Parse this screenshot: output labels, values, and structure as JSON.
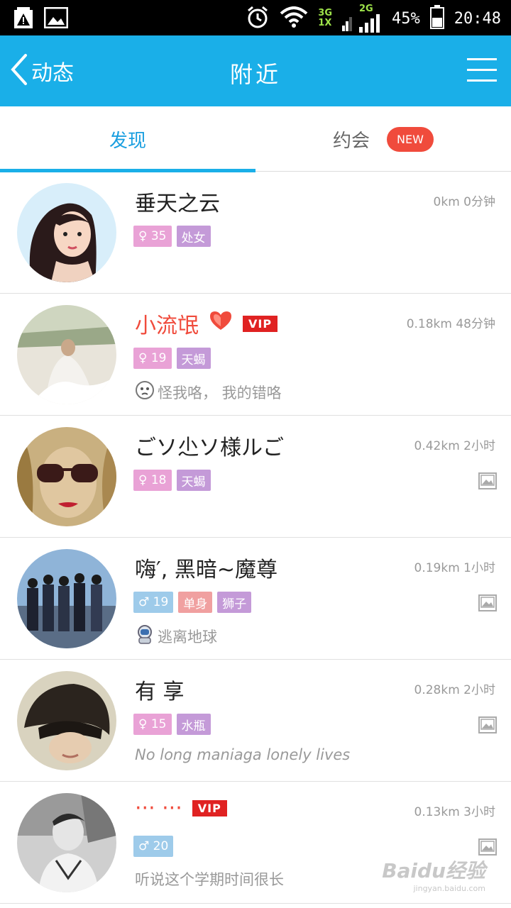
{
  "status_bar": {
    "network_top": "3G",
    "network_bottom": "1X",
    "network_2g": "2G",
    "battery": "45%",
    "time": "20:48",
    "icons": [
      "warning-battery-icon",
      "image-icon",
      "alarm-icon",
      "wifi-icon",
      "signal-icon",
      "battery-icon"
    ]
  },
  "header": {
    "back_label": "动态",
    "title": "附近",
    "background": "#1aafe8"
  },
  "tabs": {
    "discover": "发现",
    "date": "约会",
    "new_badge": "NEW"
  },
  "users": [
    {
      "name": "垂天之云",
      "meta": "0km 0分钟",
      "gender": "female",
      "age": "35",
      "tags": [
        "处女"
      ],
      "signature": "",
      "vip": false,
      "heart": false,
      "photos": false
    },
    {
      "name": "小流氓",
      "meta": "0.18km 48分钟",
      "gender": "female",
      "age": "19",
      "tags": [
        "天蝎"
      ],
      "signature": "怪我咯， 我的错咯",
      "vip": true,
      "vip_label": "VIP",
      "heart": true,
      "photos": false
    },
    {
      "name": "ごソ尐ソ様ルご",
      "meta": "0.42km 2小时",
      "gender": "female",
      "age": "18",
      "tags": [
        "天蝎"
      ],
      "signature": "",
      "vip": false,
      "heart": false,
      "photos": true
    },
    {
      "name": "嗨′, 黑暗~魔尊",
      "meta": "0.19km 1小时",
      "gender": "male",
      "age": "19",
      "tags": [
        "单身",
        "狮子"
      ],
      "signature": "逃离地球",
      "vip": false,
      "heart": false,
      "photos": true
    },
    {
      "name": "有 享",
      "meta": "0.28km 2小时",
      "gender": "female",
      "age": "15",
      "tags": [
        "水瓶"
      ],
      "signature": "No long maniaga lonely lives",
      "vip": false,
      "heart": false,
      "photos": true
    },
    {
      "name": "··· ···",
      "meta": "0.13km 3小时",
      "gender": "male",
      "age": "20",
      "tags": [],
      "signature": "听说这个学期时间很长",
      "vip": true,
      "vip_label": "VIP",
      "heart": false,
      "photos": true
    }
  ],
  "watermark": {
    "main": "Baidu经验",
    "sub": "jingyan.baidu.com"
  },
  "colors": {
    "accent": "#1aafe8",
    "tag_female": "#e9a2d6",
    "tag_male": "#9ecbea",
    "vip": "#e02222",
    "new": "#f04b3c"
  }
}
